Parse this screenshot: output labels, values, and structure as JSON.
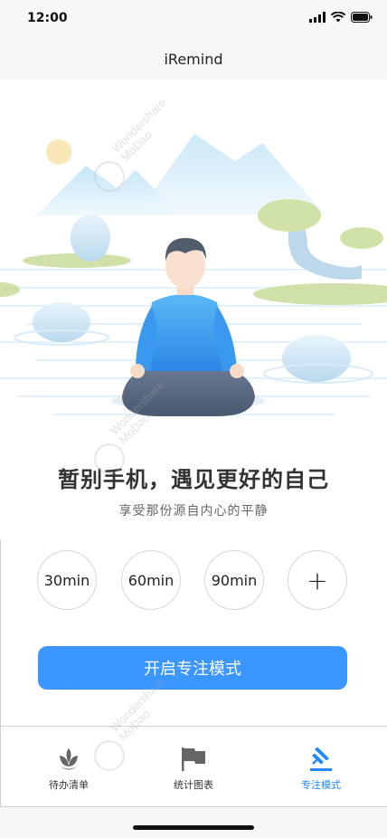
{
  "status_bar": {
    "time": "12:00"
  },
  "app": {
    "title": "iRemind"
  },
  "hero": {
    "headline": "暂别手机，遇见更好的自己",
    "subline": "享受那份源自内心的平静"
  },
  "durations": [
    "30min",
    "60min",
    "90min"
  ],
  "add_symbol": "+",
  "start_button": "开启专注模式",
  "tabs": [
    {
      "label": "待办清单",
      "icon": "lotus-icon"
    },
    {
      "label": "统计图表",
      "icon": "flag-icon"
    },
    {
      "label": "专注模式",
      "icon": "focus-icon"
    }
  ],
  "watermark": {
    "line1": "Wondershare",
    "line2": "MoDao"
  },
  "colors": {
    "accent": "#3b96ff",
    "active_tab": "#1e88ff"
  }
}
